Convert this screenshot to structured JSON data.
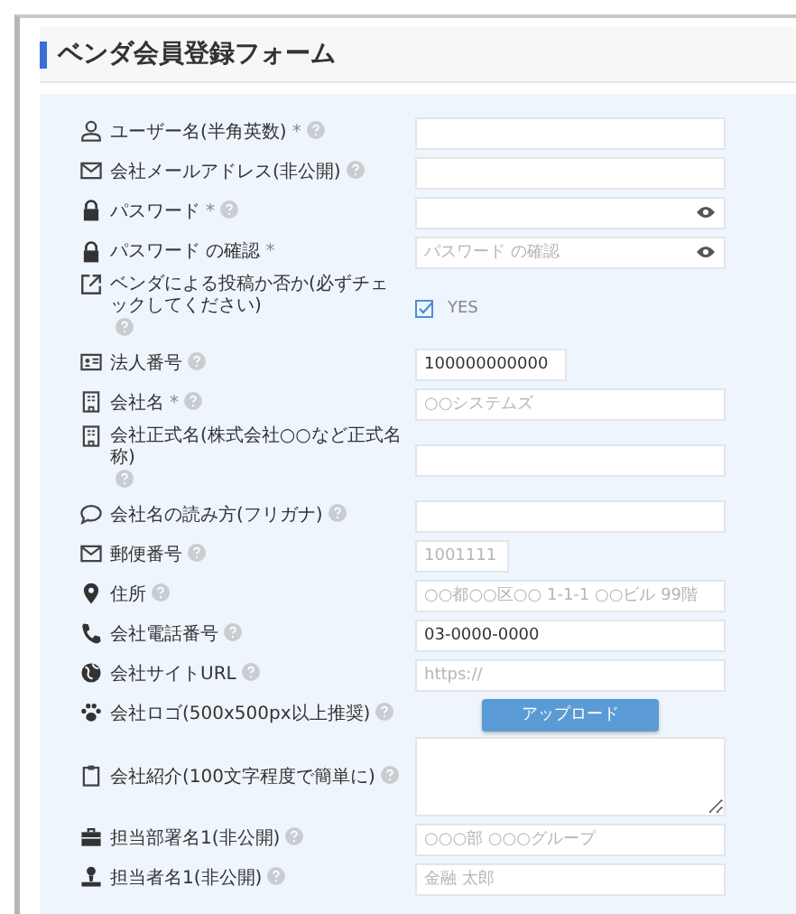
{
  "title": "ベンダ会員登録フォーム",
  "fields": [
    {
      "kind": "text",
      "label": "ユーザー名(半角英数)",
      "required_mark": "*",
      "help": true
    },
    {
      "kind": "text",
      "label": "会社メールアドレス(非公開)",
      "help": true
    },
    {
      "kind": "password",
      "label": "パスワード",
      "required_mark": "*",
      "help": true,
      "reveal": true
    },
    {
      "kind": "password",
      "label": "パスワード の確認",
      "required_mark": "*",
      "help": false,
      "reveal": true,
      "placeholder": "パスワード の確認"
    },
    {
      "kind": "checkbox",
      "label": "ベンダによる投稿か否か(必ずチェックしてください)",
      "help": true,
      "checked": true,
      "option": "YES"
    },
    {
      "kind": "number",
      "label": "法人番号",
      "help": true,
      "value": "100000000000"
    },
    {
      "kind": "text",
      "label": "会社名",
      "required_mark": "*",
      "help": true,
      "placeholder": "○○システムズ"
    },
    {
      "kind": "text",
      "label": "会社正式名(株式会社○○など正式名称)",
      "help": true
    },
    {
      "kind": "text",
      "label": "会社名の読み方(フリガナ)",
      "help": true
    },
    {
      "kind": "postal",
      "label": "郵便番号",
      "help": true,
      "placeholder": "1001111"
    },
    {
      "kind": "text",
      "label": "住所",
      "help": true,
      "placeholder": "○○都○○区○○ 1-1-1 ○○ビル 99階"
    },
    {
      "kind": "text",
      "label": "会社電話番号",
      "help": true,
      "value": "03-0000-0000"
    },
    {
      "kind": "text",
      "label": "会社サイトURL",
      "help": true,
      "placeholder": "https://"
    },
    {
      "kind": "upload",
      "label": "会社ロゴ(500x500px以上推奨)",
      "help": true,
      "button": "アップロード"
    },
    {
      "kind": "textarea",
      "label": "会社紹介(100文字程度で簡単に)",
      "help": true
    },
    {
      "kind": "text",
      "label": "担当部署名1(非公開)",
      "help": true,
      "placeholder": "○○○部 ○○○グループ"
    },
    {
      "kind": "text",
      "label": "担当者名1(非公開)",
      "help": true,
      "placeholder": "金融 太郎"
    }
  ]
}
